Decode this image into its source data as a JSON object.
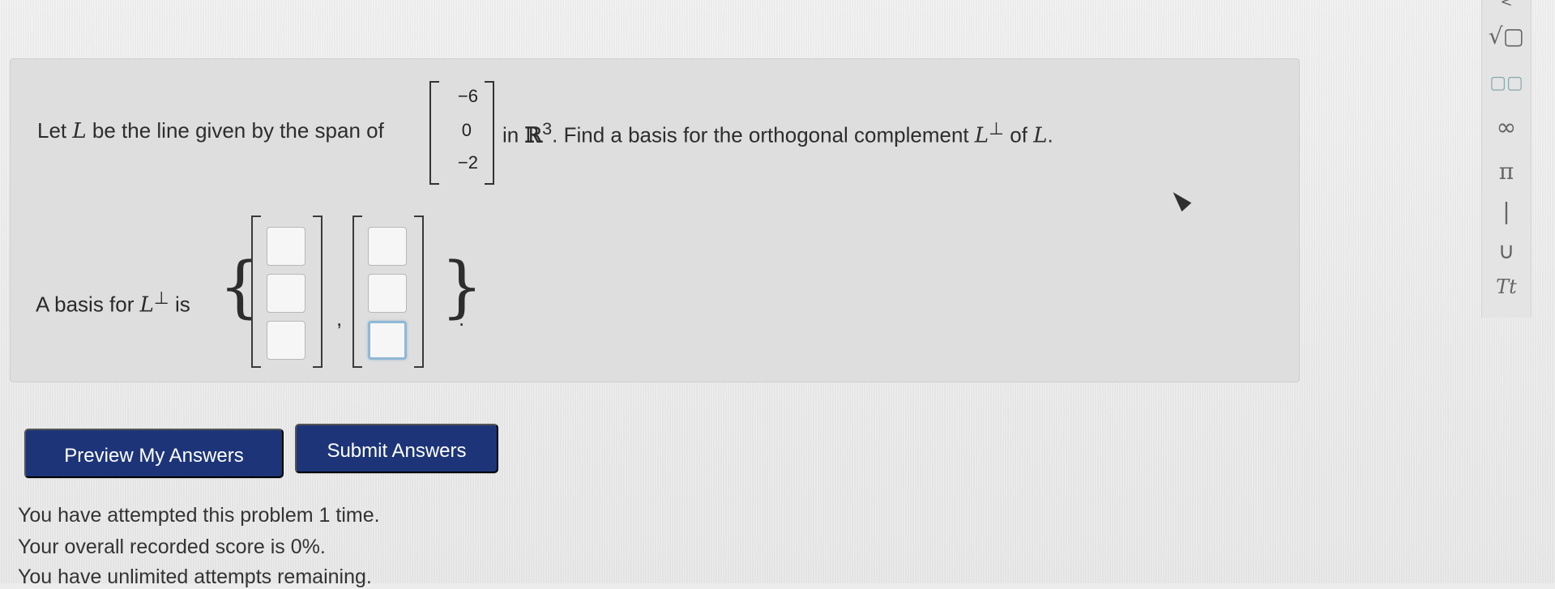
{
  "problem": {
    "prefix": "Let",
    "line_symbol": "L",
    "middle": "be the line given by the span of",
    "span_vector": [
      "−6",
      "0",
      "−2"
    ],
    "after_vector": "in",
    "space_symbol": "ℝ",
    "space_exponent": "3",
    "question": ". Find a basis for the orthogonal complement",
    "complement_symbol": "L",
    "complement_superscript": "⊥",
    "of": "of",
    "final_symbol": "L",
    "final_punctuation": "."
  },
  "answer": {
    "label_prefix": "A basis for",
    "label_symbol": "L",
    "label_superscript": "⊥",
    "label_suffix": "is",
    "brace_open": "{",
    "brace_close": "}",
    "separator": ",",
    "end_punctuation": ".",
    "vector_1": [
      "",
      "",
      ""
    ],
    "vector_2": [
      "",
      "",
      ""
    ]
  },
  "buttons": {
    "preview": "Preview My Answers",
    "submit": "Submit Answers"
  },
  "status": {
    "attempts": "You have attempted this problem 1 time.",
    "score": "Your overall recorded score is 0%.",
    "remaining": "You have unlimited attempts remaining."
  },
  "palette": {
    "items": [
      "<",
      "√▢",
      "▢▢",
      "∞",
      "π",
      "|",
      "∪",
      "Tt"
    ]
  },
  "icons": {
    "cursor": "mouse-pointer-icon"
  }
}
